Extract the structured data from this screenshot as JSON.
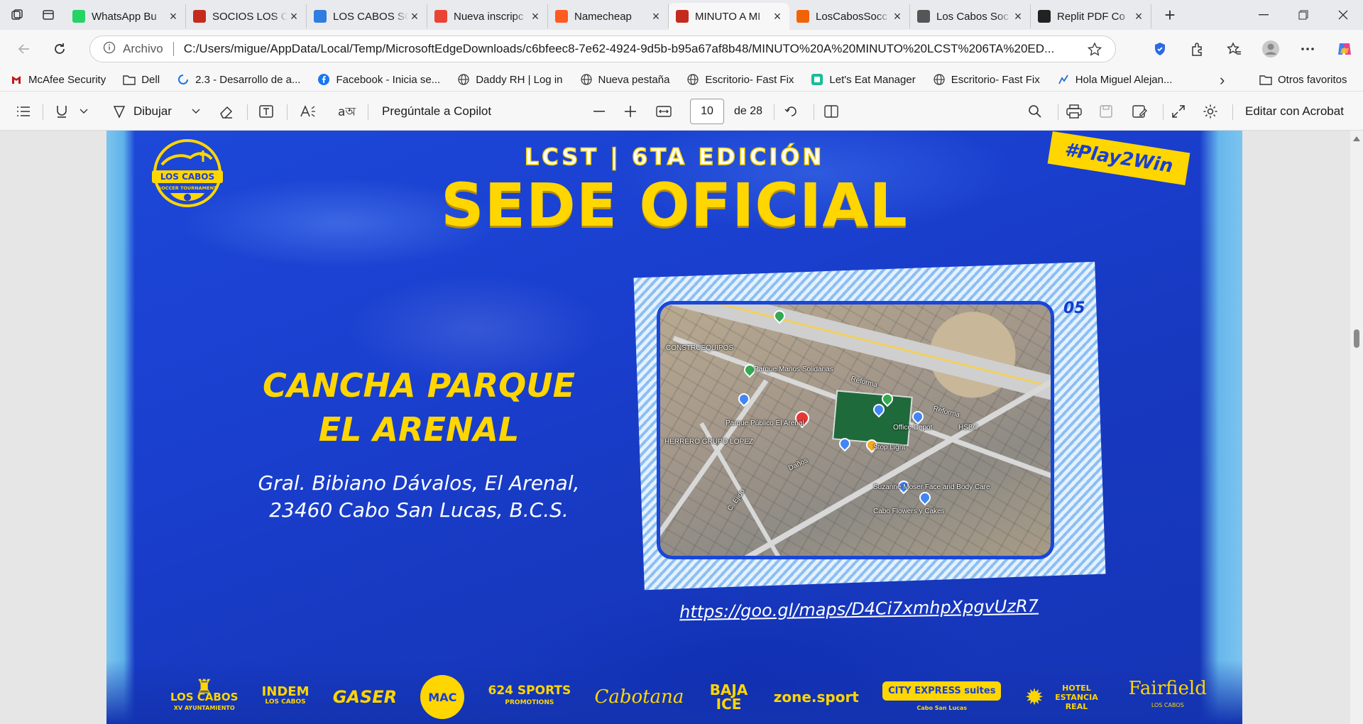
{
  "browser": {
    "tabs": [
      {
        "title": "WhatsApp Bu",
        "favicon": "whatsapp-icon",
        "color": "#25d366"
      },
      {
        "title": "SOCIOS LOS C",
        "favicon": "pdf-icon",
        "color": "#c42b1c"
      },
      {
        "title": "LOS CABOS SC",
        "favicon": "s-icon",
        "color": "#2f7de1"
      },
      {
        "title": "Nueva inscripc",
        "favicon": "gmail-icon",
        "color": "#ea4335"
      },
      {
        "title": "Namecheap",
        "favicon": "namecheap-icon",
        "color": "#ff5a1f"
      },
      {
        "title": "MINUTO A MI",
        "favicon": "pdf-icon",
        "color": "#c42b1c",
        "active": true
      },
      {
        "title": "LosCabosSocc",
        "favicon": "replit-icon",
        "color": "#f26207"
      },
      {
        "title": "Los Cabos Soc",
        "favicon": "globe-icon",
        "color": "#555555"
      },
      {
        "title": "Replit PDF Co",
        "favicon": "openai-icon",
        "color": "#222222"
      }
    ],
    "address": {
      "scheme_label": "Archivo",
      "url": "C:/Users/migue/AppData/Local/Temp/MicrosoftEdgeDownloads/c6bfeec8-7e62-4924-9d5b-b95a67af8b48/MINUTO%20A%20MINUTO%20LCST%206TA%20ED..."
    },
    "favorites": [
      {
        "label": "McAfee Security",
        "icon": "mcafee-icon"
      },
      {
        "label": "Dell",
        "icon": "folder-icon"
      },
      {
        "label": "2.3 - Desarrollo de a...",
        "icon": "loading-icon"
      },
      {
        "label": "Facebook - Inicia se...",
        "icon": "facebook-icon"
      },
      {
        "label": "Daddy RH | Log in",
        "icon": "globe-icon"
      },
      {
        "label": "Nueva pestaña",
        "icon": "globe-icon"
      },
      {
        "label": "Escritorio- Fast Fix",
        "icon": "globe-icon"
      },
      {
        "label": "Let's Eat Manager",
        "icon": "app-icon"
      },
      {
        "label": "Escritorio- Fast Fix",
        "icon": "globe-icon"
      },
      {
        "label": "Hola Miguel Alejan...",
        "icon": "chart-icon"
      }
    ],
    "favorites_other": "Otros favoritos"
  },
  "pdf_toolbar": {
    "draw_label": "Dibujar",
    "copilot_label": "Pregúntale a Copilot",
    "page_current": "10",
    "page_total": "de 28",
    "acrobat_label": "Editar con Acrobat"
  },
  "slide": {
    "subheader": "LCST | 6TA EDICIÓN",
    "header": "SEDE OFICIAL",
    "tag": "#Play2Win",
    "venue_line1": "CANCHA PARQUE",
    "venue_line2": "EL ARENAL",
    "address_line1": "Gral. Bibiano Dávalos, El Arenal,",
    "address_line2": "23460 Cabo San Lucas, B.C.S.",
    "map_number": "05",
    "map_link": "https://goo.gl/maps/D4Ci7xmhpXpgvUzR7",
    "logo_text": "LOS CABOS",
    "logo_sub": "SOCCER TOURNAMENT",
    "map_labels": [
      "CONSTRUEQUIPOS",
      "Parque Manos Solidarias",
      "Reforma",
      "Reforma",
      "Parque Público El Arenal",
      "Office Depot",
      "HSBC",
      "HERRERO GRUPO LOPEZ",
      "Stop Light",
      "Suzanne Moser Face and Body Care",
      "Cabo Flowers y Cakes",
      "C. Ejido",
      "Daños"
    ],
    "sponsors": [
      {
        "name": "LOS CABOS",
        "sub": "XV AYUNTAMIENTO"
      },
      {
        "name": "INDEM",
        "sub": "LOS CABOS"
      },
      {
        "name": "GASER",
        "sub": ""
      },
      {
        "name": "MAC",
        "sub": ""
      },
      {
        "name": "624 SPORTS",
        "sub": "PROMOTIONS"
      },
      {
        "name": "Cabotana",
        "sub": ""
      },
      {
        "name": "BAJA ICE",
        "sub": ""
      },
      {
        "name": "zone.sport",
        "sub": ""
      },
      {
        "name": "CITY EXPRESS suites",
        "sub": "Cabo San Lucas"
      },
      {
        "name": "HOTEL ESTANCIA REAL",
        "sub": ""
      },
      {
        "name": "Fairfield",
        "sub": "LOS CABOS"
      }
    ]
  },
  "colors": {
    "slide_blue": "#1a3fcf",
    "brand_yellow": "#ffd600",
    "edge_accent": "#2563eb"
  }
}
